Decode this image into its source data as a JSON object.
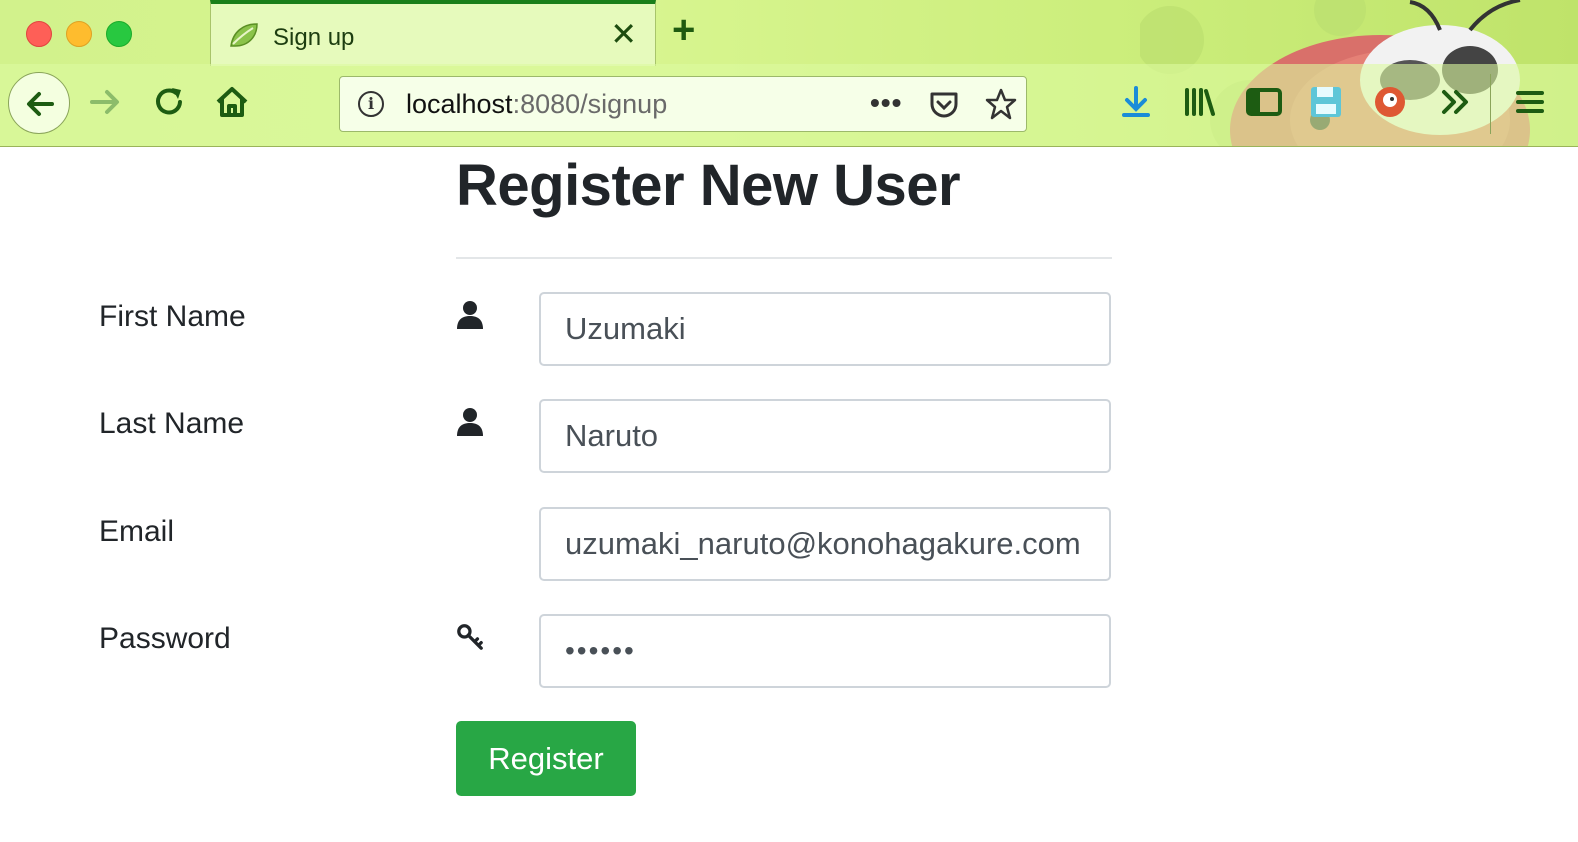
{
  "browser": {
    "tab_title": "Sign up",
    "url_host": "localhost",
    "url_rest": ":8080/signup",
    "accent": "#1a7f1a"
  },
  "page": {
    "heading": "Register New User",
    "fields": [
      {
        "label": "First Name",
        "value": "Uzumaki",
        "icon": "user-icon"
      },
      {
        "label": "Last Name",
        "value": "Naruto",
        "icon": "user-icon"
      },
      {
        "label": "Email",
        "value": "uzumaki_naruto@konohagakure.com",
        "icon": null
      },
      {
        "label": "Password",
        "value": "••••••",
        "icon": "key-icon"
      }
    ],
    "submit_label": "Register",
    "submit_color": "#28a745"
  }
}
